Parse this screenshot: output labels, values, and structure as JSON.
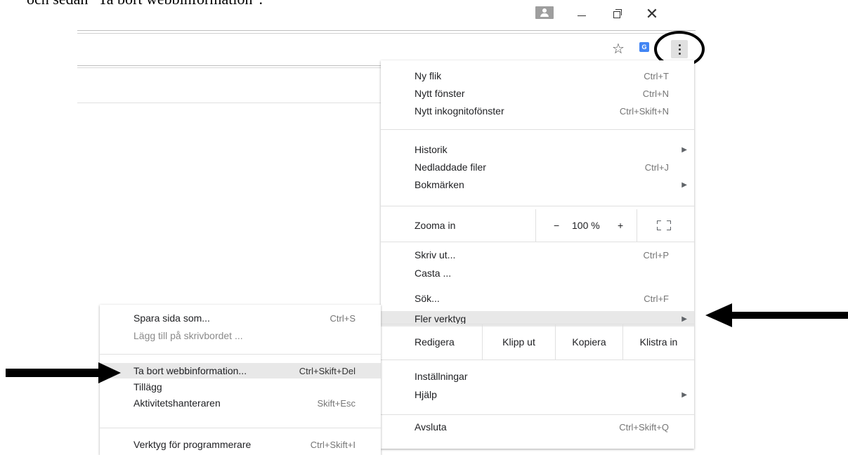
{
  "caption": "och sedan \"Ta bort webbinformation\".",
  "window_controls": {
    "user": "user-icon",
    "minimize": "minimize-icon",
    "restore": "restore-icon",
    "close": "close-icon",
    "close_glyph": "✕"
  },
  "toolbar": {
    "star_glyph": "☆",
    "extension_label": "G"
  },
  "main_menu": {
    "items": [
      {
        "label": "Ny flik",
        "shortcut": "Ctrl+T"
      },
      {
        "label": "Nytt fönster",
        "shortcut": "Ctrl+N"
      },
      {
        "label": "Nytt inkognitofönster",
        "shortcut": "Ctrl+Skift+N"
      },
      {
        "label": "Historik",
        "arrow": "▶"
      },
      {
        "label": "Nedladdade filer",
        "shortcut": "Ctrl+J"
      },
      {
        "label": "Bokmärken",
        "arrow": "▶"
      },
      {
        "label": "Skriv ut...",
        "shortcut": "Ctrl+P"
      },
      {
        "label": "Casta ..."
      },
      {
        "label": "Sök...",
        "shortcut": "Ctrl+F"
      },
      {
        "label": "Fler verktyg",
        "arrow": "▶"
      },
      {
        "label": "Inställningar"
      },
      {
        "label": "Hjälp",
        "arrow": "▶"
      },
      {
        "label": "Avsluta",
        "shortcut": "Ctrl+Skift+Q"
      }
    ],
    "zoom": {
      "label": "Zooma in",
      "minus": "−",
      "value": "100 %",
      "plus": "+"
    },
    "edit": {
      "label": "Redigera",
      "cut": "Klipp ut",
      "copy": "Kopiera",
      "paste": "Klistra in"
    }
  },
  "sub_menu": {
    "items": [
      {
        "label": "Spara sida som...",
        "shortcut": "Ctrl+S"
      },
      {
        "label": "Lägg till på skrivbordet ..."
      },
      {
        "label": "Ta bort webbinformation...",
        "shortcut": "Ctrl+Skift+Del"
      },
      {
        "label": "Tillägg"
      },
      {
        "label": "Aktivitetshanteraren",
        "shortcut": "Skift+Esc"
      },
      {
        "label": "Verktyg för programmerare",
        "shortcut": "Ctrl+Skift+I"
      }
    ]
  },
  "colors": {
    "highlight_row": "#e8e8e8",
    "annotation": "#000000"
  }
}
